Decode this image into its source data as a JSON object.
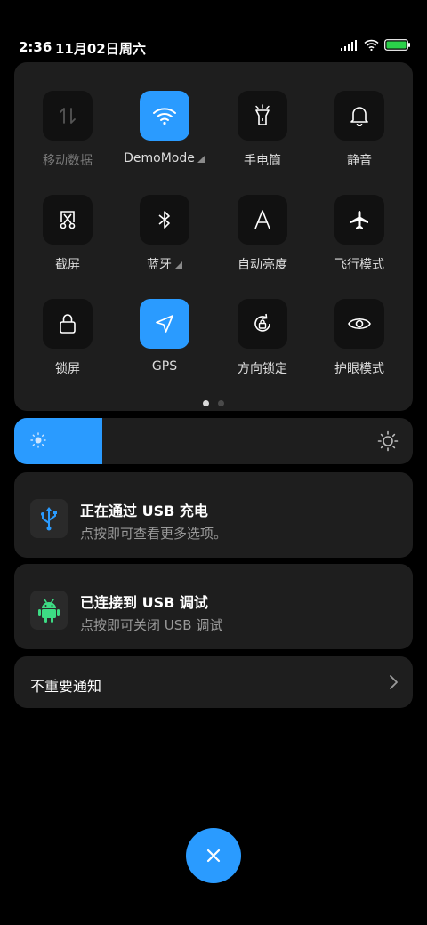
{
  "status_bar": {
    "time": "2:36",
    "date": "11月02日",
    "weekday": "周六",
    "icons": [
      "signal-icon",
      "wifi-icon",
      "battery-icon"
    ],
    "battery_color": "#2bd14a"
  },
  "quick_settings": {
    "tiles": [
      {
        "label": "移动数据",
        "icon": "mobile-data-icon",
        "active": false,
        "dim": true
      },
      {
        "label": "DemoMode",
        "icon": "wifi-icon",
        "active": true,
        "has_more": true
      },
      {
        "label": "手电筒",
        "icon": "flashlight-icon",
        "active": false
      },
      {
        "label": "静音",
        "icon": "bell-icon",
        "active": false
      },
      {
        "label": "截屏",
        "icon": "screenshot-scissors-icon",
        "active": false
      },
      {
        "label": "蓝牙",
        "icon": "bluetooth-icon",
        "active": false,
        "has_more": true
      },
      {
        "label": "自动亮度",
        "icon": "auto-brightness-icon",
        "active": false
      },
      {
        "label": "飞行模式",
        "icon": "airplane-icon",
        "active": false
      },
      {
        "label": "锁屏",
        "icon": "lock-icon",
        "active": false
      },
      {
        "label": "GPS",
        "icon": "location-arrow-icon",
        "active": true
      },
      {
        "label": "方向锁定",
        "icon": "rotation-lock-icon",
        "active": false
      },
      {
        "label": "护眼模式",
        "icon": "eye-icon",
        "active": false
      }
    ],
    "page_count": 2,
    "current_page": 1,
    "accent_color": "#2a9bff"
  },
  "brightness": {
    "level": 0.22,
    "icons": [
      "sun-small-icon",
      "sun-large-icon"
    ]
  },
  "notifications": [
    {
      "title": "正在通过 USB 充电",
      "subtitle": "点按即可查看更多选项。",
      "icon": "usb-icon"
    },
    {
      "title": "已连接到 USB 调试",
      "subtitle": "点按即可关闭 USB 调试",
      "icon": "android-icon"
    }
  ],
  "minor_notifications": {
    "label": "不重要通知",
    "icon": "chevron-right-icon"
  },
  "close_button": {
    "icon": "close-icon"
  }
}
